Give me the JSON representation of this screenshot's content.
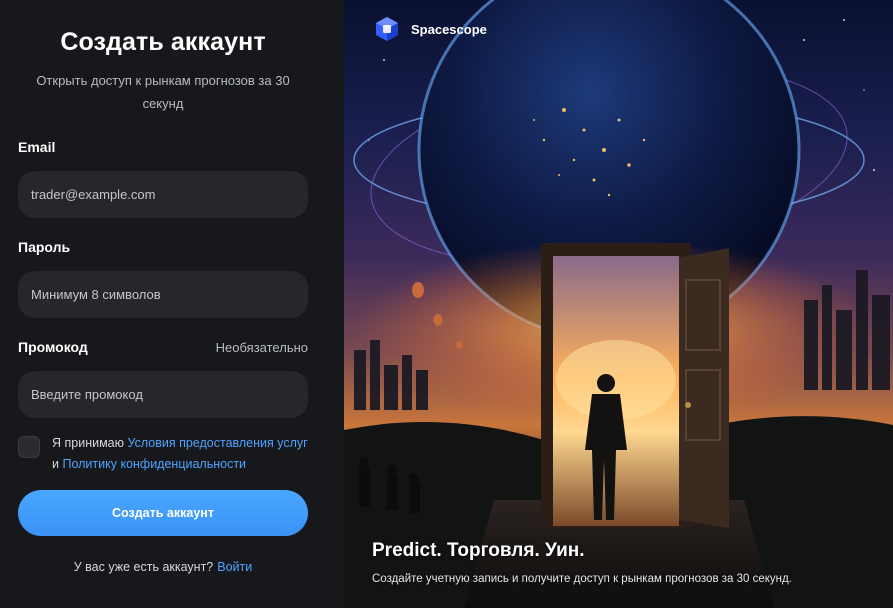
{
  "form": {
    "title": "Создать аккаунт",
    "subtitle": "Открыть доступ к рынкам прогнозов за 30 секунд",
    "email": {
      "label": "Email",
      "placeholder": "trader@example.com"
    },
    "password": {
      "label": "Пароль",
      "placeholder": "Минимум 8 символов"
    },
    "promo": {
      "label": "Промокод",
      "optional": "Необязательно",
      "placeholder": "Введите промокод"
    },
    "terms": {
      "prefix": "Я принимаю ",
      "terms_link": "Условия предоставления услуг",
      "and": " и ",
      "privacy_link": "Политику конфиденциальности"
    },
    "submit_label": "Создать аккаунт",
    "signin_prompt": "У вас уже есть аккаунт?",
    "signin_link": "Войти"
  },
  "promo_panel": {
    "brand": "Spacescope",
    "logo_icon": "cube-logo-icon",
    "headline": "Predict. Торговля. Уин.",
    "subline": "Создайте учетную запись и получите доступ к рынкам прогнозов за 30 секунд."
  },
  "colors": {
    "accent": "#3f9cfb",
    "panel_bg": "#17181b",
    "input_bg": "#25272b",
    "link": "#4ea4ff"
  }
}
